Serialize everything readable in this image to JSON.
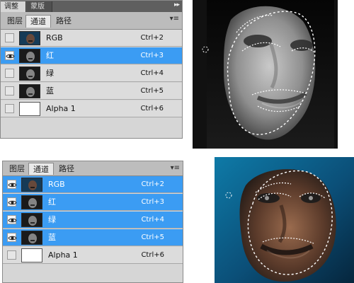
{
  "top_panel": {
    "strip_tabs": [
      "调整",
      "蒙版"
    ],
    "tabs": [
      "图层",
      "通道",
      "路径"
    ],
    "menu_icon": "panel-menu-icon",
    "rows": [
      {
        "label": "RGB",
        "shortcut": "Ctrl+2",
        "selected": false,
        "visible": false
      },
      {
        "label": "红",
        "shortcut": "Ctrl+3",
        "selected": true,
        "visible": true
      },
      {
        "label": "绿",
        "shortcut": "Ctrl+4",
        "selected": false,
        "visible": false
      },
      {
        "label": "蓝",
        "shortcut": "Ctrl+5",
        "selected": false,
        "visible": false
      },
      {
        "label": "Alpha 1",
        "shortcut": "Ctrl+6",
        "selected": false,
        "visible": false
      }
    ]
  },
  "bottom_panel": {
    "tabs": [
      "图层",
      "通道",
      "路径"
    ],
    "menu_icon": "panel-menu-icon",
    "rows": [
      {
        "label": "RGB",
        "shortcut": "Ctrl+2",
        "selected": true,
        "visible": true
      },
      {
        "label": "红",
        "shortcut": "Ctrl+3",
        "selected": true,
        "visible": true
      },
      {
        "label": "绿",
        "shortcut": "Ctrl+4",
        "selected": true,
        "visible": true
      },
      {
        "label": "蓝",
        "shortcut": "Ctrl+5",
        "selected": true,
        "visible": true
      },
      {
        "label": "Alpha 1",
        "shortcut": "Ctrl+6",
        "selected": false,
        "visible": false
      }
    ]
  },
  "colors": {
    "selected_row": "#3b9cf3",
    "panel_bg": "#d6d6d6",
    "tab_strip": "#5f5f5f"
  }
}
